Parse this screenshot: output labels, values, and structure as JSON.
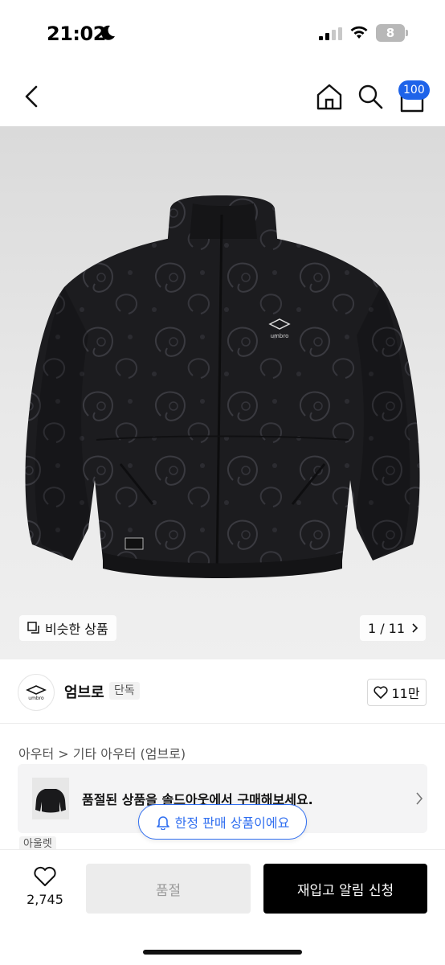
{
  "status_bar": {
    "time": "21:02",
    "battery": "8",
    "icons": [
      "moon-icon",
      "signal-icon",
      "wifi-icon",
      "battery-icon"
    ]
  },
  "nav": {
    "icons": [
      "back-icon",
      "home-icon",
      "search-icon",
      "cart-icon"
    ],
    "cart_badge": "100",
    "cart_badge_color": "#1e63e9"
  },
  "hero": {
    "similar_label": "비슷한 상품",
    "pager": "1 / 11",
    "pager_icon": "chevron-right-icon",
    "jacket_brand_text": "umbro"
  },
  "brand": {
    "name": "엄브로",
    "tag": "단독",
    "logo_text": "umbro",
    "like_count": "11만"
  },
  "breadcrumb": "아우터 > 기타 아우터 (엄브로)",
  "soldout_banner": {
    "text": "품절된 상품을 솔드아웃에서 구매해보세요."
  },
  "outlet_tag": "아울렛",
  "limited_pill": {
    "text": "한정 판매 상품이에요",
    "color": "#2f6ef0"
  },
  "bottom_bar": {
    "wish_count": "2,745",
    "soldout_label": "품절",
    "restock_label": "재입고 알림 신청"
  }
}
